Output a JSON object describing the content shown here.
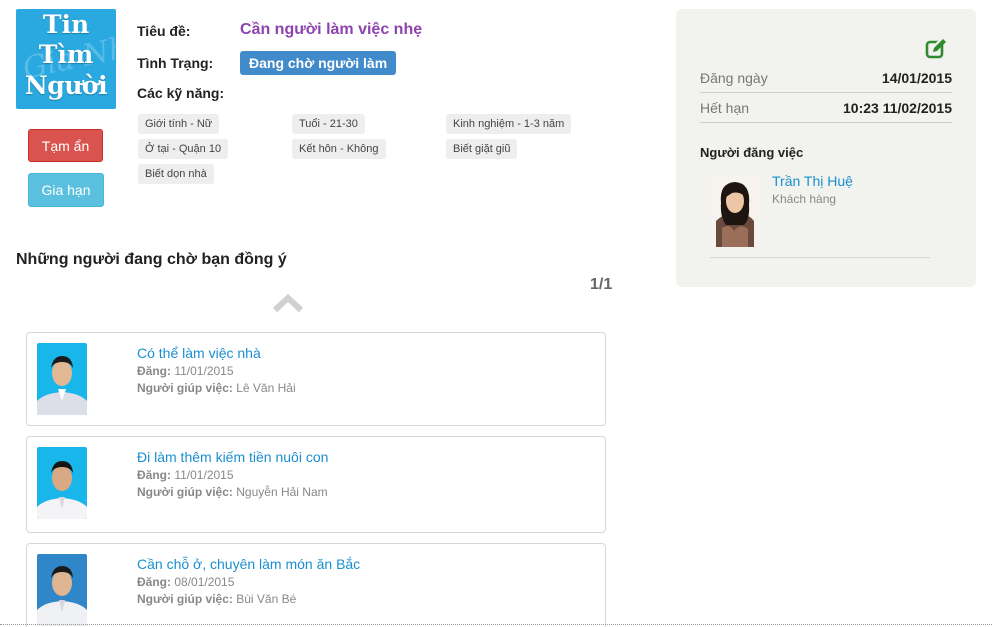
{
  "logo": {
    "line1": "Tin",
    "line2": "Tìm",
    "line3": "Người",
    "bg_script": "Gia Nhà"
  },
  "actions": {
    "hide_label": "Tạm ẩn",
    "extend_label": "Gia hạn"
  },
  "job": {
    "title_label": "Tiêu đề:",
    "title_value": "Cần người làm việc nhẹ",
    "status_label": "Tình Trạng:",
    "status_value": "Đang chờ người làm",
    "skills_label": "Các kỹ năng:",
    "skills": [
      "Giới tính - Nữ",
      "Tuổi - 21-30",
      "Kinh nghiệm - 1-3 năm",
      "Ở tại - Quận 10",
      "Kết hôn - Không",
      "Biết giặt giũ",
      "Biết dọn nhà"
    ]
  },
  "applicants": {
    "heading": "Những người đang chờ bạn đồng ý",
    "pager": "1/1",
    "posted_label": "Đăng:",
    "helper_label": "Người giúp việc:",
    "items": [
      {
        "title": "Có thể làm việc nhà",
        "posted": "11/01/2015",
        "helper": "Lê Văn Hải"
      },
      {
        "title": "Đi làm thêm kiếm tiền nuôi con",
        "posted": "11/01/2015",
        "helper": "Nguyễn Hải Nam"
      },
      {
        "title": "Cần chỗ ở, chuyên làm món ăn Bắc",
        "posted": "08/01/2015",
        "helper": "Bùi Văn Bé"
      }
    ]
  },
  "panel": {
    "posted_date_label": "Đăng ngày",
    "posted_date_value": "14/01/2015",
    "expiry_label": "Hết hạn",
    "expiry_value": "10:23 11/02/2015",
    "poster_label": "Người đăng việc",
    "poster_name": "Trần Thị Huệ",
    "poster_role": "Khách hàng"
  },
  "colors": {
    "accent_blue": "#428bca",
    "link_blue": "#1a8fd0",
    "title_purple": "#8e44ad",
    "danger": "#d9534f",
    "info": "#5bc0de",
    "panel_bg": "#f2f2ee",
    "edit_green": "#2e8b2e"
  },
  "icons": {
    "edit": "edit-icon",
    "scroll_up": "chevron-up-icon"
  }
}
